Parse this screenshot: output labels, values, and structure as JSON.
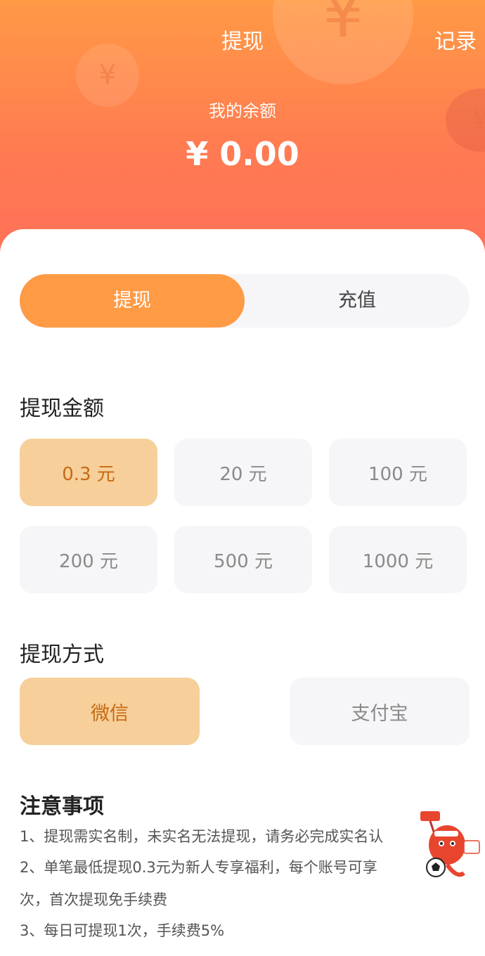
{
  "header": {
    "title": "提现",
    "record_label": "记录",
    "balance_label": "我的余额",
    "balance_value": "¥ 0.00",
    "coin_symbol": "¥"
  },
  "tabs": [
    {
      "label": "提现",
      "active": true
    },
    {
      "label": "充值",
      "active": false
    }
  ],
  "amount_section": {
    "title": "提现金额",
    "options": [
      {
        "label": "0.3 元",
        "selected": true
      },
      {
        "label": "20 元",
        "selected": false
      },
      {
        "label": "100 元",
        "selected": false
      },
      {
        "label": "200 元",
        "selected": false
      },
      {
        "label": "500 元",
        "selected": false
      },
      {
        "label": "1000 元",
        "selected": false
      }
    ]
  },
  "method_section": {
    "title": "提现方式",
    "options": [
      {
        "label": "微信",
        "selected": true
      },
      {
        "label": "支付宝",
        "selected": false
      }
    ]
  },
  "notes": {
    "title": "注意事项",
    "lines": [
      "1、提现需实名制，未实名无法提现，请务必完成实名认",
      "2、单笔最低提现0.3元为新人专享福利，每个账号可享",
      "次，首次提现免手续费",
      "3、每日可提现1次，手续费5%"
    ]
  },
  "colors": {
    "header_top": "#ff9a45",
    "header_bottom": "#ff6e5a",
    "accent": "#ff9a45",
    "selected_bg": "#f6cf9a",
    "selected_text": "#c76a13",
    "chip_bg": "#f6f5f7"
  }
}
